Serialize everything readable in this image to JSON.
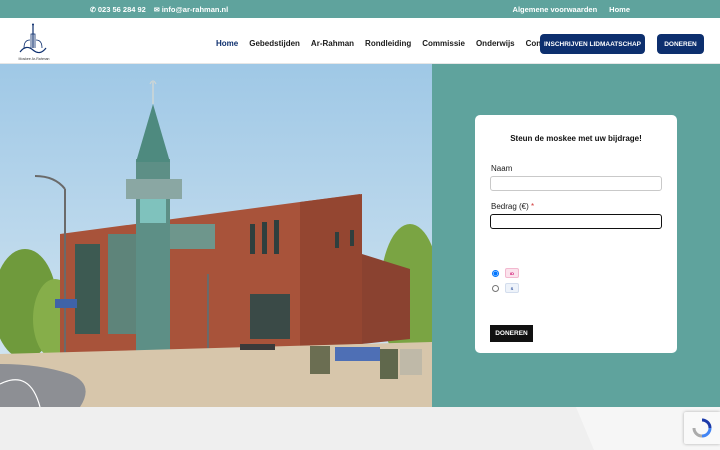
{
  "topbar": {
    "phone": "023 56 284 92",
    "email": "info@ar-rahman.nl",
    "links": [
      "Algemene voorwaarden",
      "Home"
    ]
  },
  "header": {
    "logo_caption": "Moskee Ar-Rahman",
    "nav": [
      "Home",
      "Gebedstijden",
      "Ar-Rahman",
      "Rondleiding",
      "Commissie",
      "Onderwijs",
      "Contact"
    ],
    "active_nav": "Home",
    "membership_button": "INSCHRIJVEN LIDMAATSCHAP",
    "donate_button": "DONEREN"
  },
  "donation_form": {
    "title": "Steun de moskee met uw bijdrage!",
    "name_label": "Naam",
    "name_value": "",
    "amount_label": "Bedrag (€)",
    "required_mark": "*",
    "amount_value": "",
    "payment_methods": [
      "ideal-icon",
      "sepa-icon"
    ],
    "selected_payment": "ideal-icon",
    "submit_label": "DONEREN"
  },
  "colors": {
    "teal": "#5fa39d",
    "navy": "#0d2f6e",
    "black": "#111111"
  }
}
